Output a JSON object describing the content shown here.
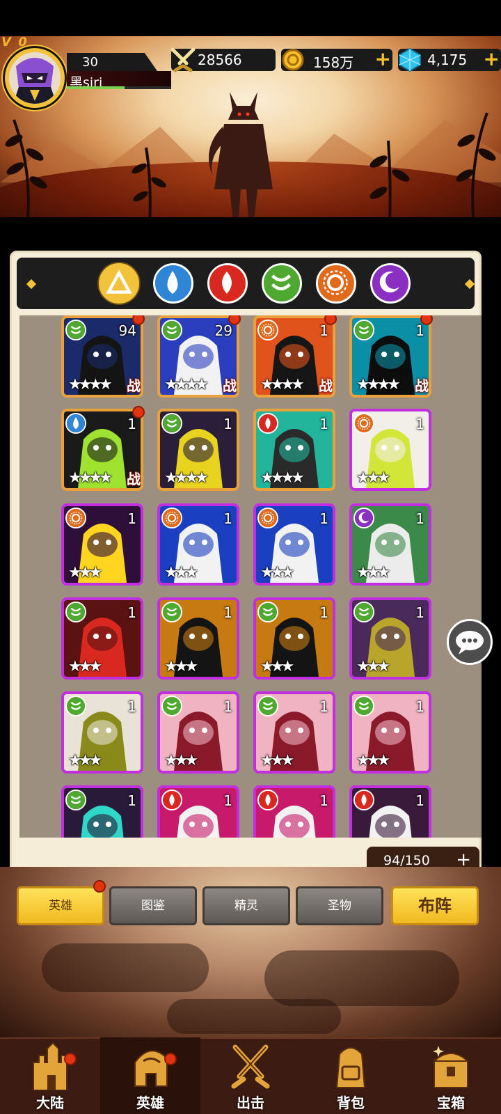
{
  "player": {
    "vip": "V 0",
    "level": "30",
    "name": "黑siri",
    "xp_fraction": 0.55
  },
  "resources": {
    "power": "28566",
    "gold": "158万",
    "gems": "4,175"
  },
  "element_filters": [
    {
      "name": "all",
      "icon": "triangle-icon",
      "color": "#f2c23a",
      "selected": true
    },
    {
      "name": "water",
      "icon": "water-drop-icon",
      "color": "#2f86d6",
      "selected": false
    },
    {
      "name": "fire",
      "icon": "fire-icon",
      "color": "#d8281f",
      "selected": false
    },
    {
      "name": "wind",
      "icon": "wind-icon",
      "color": "#4fa830",
      "selected": false
    },
    {
      "name": "light",
      "icon": "sun-icon",
      "color": "#e06a1a",
      "selected": false
    },
    {
      "name": "dark",
      "icon": "moon-icon",
      "color": "#8a2fc2",
      "selected": false
    }
  ],
  "heroes": [
    {
      "element": "wind",
      "level": "94",
      "stars": "★★★★",
      "tag": "战",
      "frame": "gold",
      "dot": true,
      "bg": "#1b2a6a",
      "fg": "#141414"
    },
    {
      "element": "wind",
      "level": "29",
      "stars": "★★★★",
      "tag": "战",
      "frame": "gold",
      "dot": true,
      "bg": "#2b3fbe",
      "fg": "#f2f2f2"
    },
    {
      "element": "light",
      "level": "1",
      "stars": "★★★★",
      "tag": "战",
      "frame": "gold",
      "dot": true,
      "bg": "#e0531c",
      "fg": "#161616"
    },
    {
      "element": "wind",
      "level": "1",
      "stars": "★★★★",
      "tag": "战",
      "frame": "gold",
      "dot": true,
      "bg": "#0b8fa7",
      "fg": "#0d0d0d"
    },
    {
      "element": "water",
      "level": "1",
      "stars": "★★★★",
      "tag": "战",
      "frame": "gold",
      "dot": true,
      "bg": "#1a1a1a",
      "fg": "#9fe22f"
    },
    {
      "element": "wind",
      "level": "1",
      "stars": "★★★★",
      "tag": "",
      "frame": "gold",
      "dot": false,
      "bg": "#2a1e3a",
      "fg": "#e8d31f"
    },
    {
      "element": "fire",
      "level": "1",
      "stars": "★★★★",
      "tag": "",
      "frame": "gold",
      "dot": false,
      "bg": "#22b59b",
      "fg": "#2a2a2a"
    },
    {
      "element": "light",
      "level": "1",
      "stars": "★★★",
      "tag": "",
      "frame": "purple",
      "dot": false,
      "bg": "#f2efe8",
      "fg": "#d2e63a"
    },
    {
      "element": "light",
      "level": "1",
      "stars": "★★★",
      "tag": "",
      "frame": "purple",
      "dot": false,
      "bg": "#2d0f3a",
      "fg": "#ffd51f"
    },
    {
      "element": "light",
      "level": "1",
      "stars": "★★★",
      "tag": "",
      "frame": "purple",
      "dot": false,
      "bg": "#1a3fc0",
      "fg": "#f2f2f2"
    },
    {
      "element": "light",
      "level": "1",
      "stars": "★★★",
      "tag": "",
      "frame": "purple",
      "dot": false,
      "bg": "#1a3fc0",
      "fg": "#f2f2f2"
    },
    {
      "element": "dark",
      "level": "1",
      "stars": "★★★",
      "tag": "",
      "frame": "purple",
      "dot": false,
      "bg": "#3c8a4a",
      "fg": "#ececec"
    },
    {
      "element": "wind",
      "level": "1",
      "stars": "★★★",
      "tag": "",
      "frame": "purple",
      "dot": false,
      "bg": "#5a1212",
      "fg": "#d8281f"
    },
    {
      "element": "wind",
      "level": "1",
      "stars": "★★★",
      "tag": "",
      "frame": "purple",
      "dot": false,
      "bg": "#c77a12",
      "fg": "#141414"
    },
    {
      "element": "wind",
      "level": "1",
      "stars": "★★★",
      "tag": "",
      "frame": "purple",
      "dot": false,
      "bg": "#c77a12",
      "fg": "#141414"
    },
    {
      "element": "wind",
      "level": "1",
      "stars": "★★★",
      "tag": "",
      "frame": "purple",
      "dot": false,
      "bg": "#4a2a5a",
      "fg": "#b8a52a"
    },
    {
      "element": "wind",
      "level": "1",
      "stars": "★★★",
      "tag": "",
      "frame": "purple",
      "dot": false,
      "bg": "#e8e3d6",
      "fg": "#8a8a1a"
    },
    {
      "element": "wind",
      "level": "1",
      "stars": "★★★",
      "tag": "",
      "frame": "purple",
      "dot": false,
      "bg": "#f0b3c2",
      "fg": "#8a1a2a"
    },
    {
      "element": "wind",
      "level": "1",
      "stars": "★★★",
      "tag": "",
      "frame": "purple",
      "dot": false,
      "bg": "#f0b3c2",
      "fg": "#8a1a2a"
    },
    {
      "element": "wind",
      "level": "1",
      "stars": "★★★",
      "tag": "",
      "frame": "purple",
      "dot": false,
      "bg": "#f0b3c2",
      "fg": "#8a1a2a"
    },
    {
      "element": "wind",
      "level": "1",
      "stars": "",
      "tag": "",
      "frame": "purple",
      "dot": false,
      "bg": "#2a1a3a",
      "fg": "#2fd7c8"
    },
    {
      "element": "fire",
      "level": "1",
      "stars": "",
      "tag": "",
      "frame": "purple",
      "dot": false,
      "bg": "#c81a6a",
      "fg": "#f2f2f2"
    },
    {
      "element": "fire",
      "level": "1",
      "stars": "",
      "tag": "",
      "frame": "purple",
      "dot": false,
      "bg": "#c81a6a",
      "fg": "#f2f2f2"
    },
    {
      "element": "fire",
      "level": "1",
      "stars": "",
      "tag": "",
      "frame": "purple",
      "dot": false,
      "bg": "#3a1a3a",
      "fg": "#f2f2f2"
    }
  ],
  "hero_count": "94/150",
  "tabs": [
    {
      "label": "英雄",
      "state": "on",
      "dot": true
    },
    {
      "label": "图鉴",
      "state": "off",
      "dot": false
    },
    {
      "label": "精灵",
      "state": "off",
      "dot": false
    },
    {
      "label": "圣物",
      "state": "off",
      "dot": false
    },
    {
      "label": "布阵",
      "state": "on",
      "dot": false
    }
  ],
  "nav": [
    {
      "label": "大陆",
      "icon": "castle-icon",
      "dot": true,
      "active": false
    },
    {
      "label": "英雄",
      "icon": "helmet-icon",
      "dot": true,
      "active": true
    },
    {
      "label": "出击",
      "icon": "crossed-swords-icon",
      "dot": false,
      "active": false
    },
    {
      "label": "背包",
      "icon": "backpack-icon",
      "dot": false,
      "active": false
    },
    {
      "label": "宝箱",
      "icon": "treasure-chest-icon",
      "dot": false,
      "active": false
    }
  ],
  "colors": {
    "gold": "#f2c23a",
    "accent_red": "#e2350f",
    "rare_purple": "#c12fe0",
    "epic_gold": "#e9a23a"
  }
}
